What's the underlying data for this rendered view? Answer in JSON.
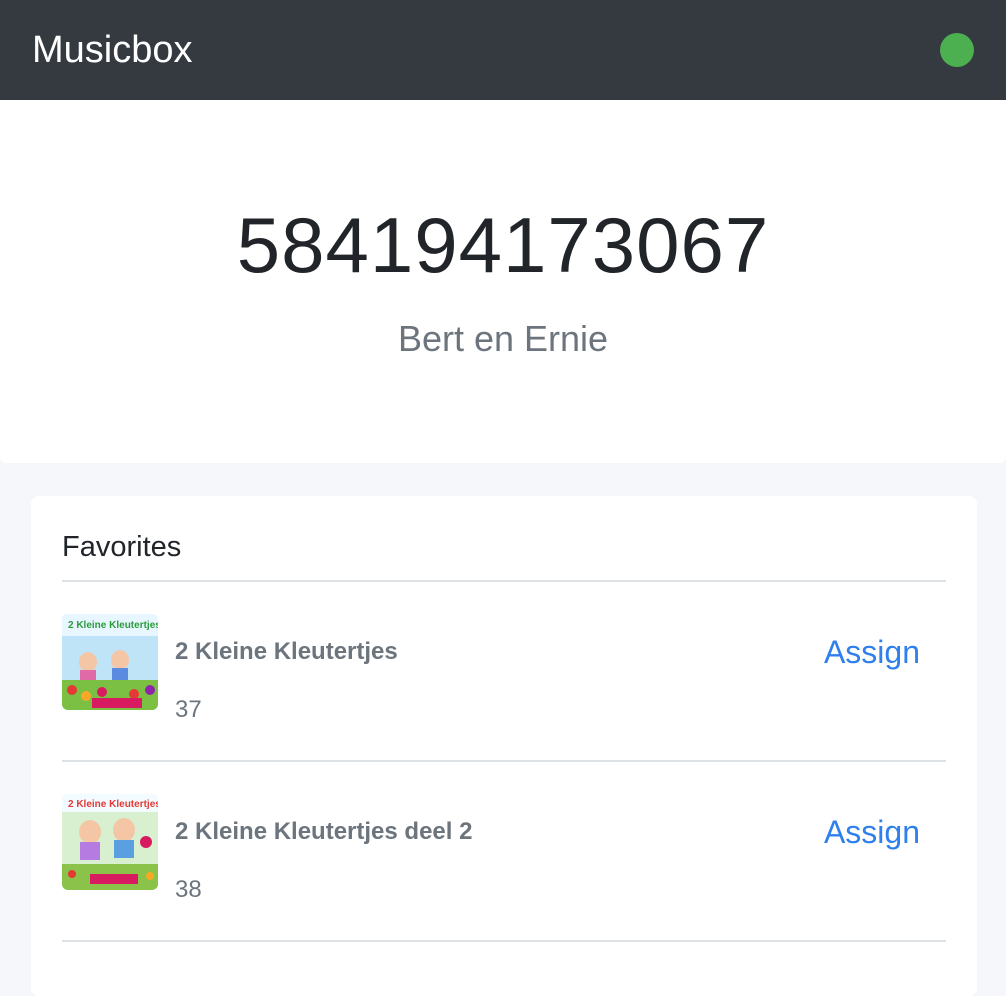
{
  "navbar": {
    "brand": "Musicbox",
    "status_color": "#4caf50"
  },
  "card": {
    "id": "584194173067",
    "name": "Bert en Ernie"
  },
  "favorites": {
    "title": "Favorites",
    "items": [
      {
        "title": "2 Kleine Kleutertjes",
        "count": "37",
        "action_label": "Assign",
        "cover_icon": "album-cover-image"
      },
      {
        "title": "2 Kleine Kleutertjes deel 2",
        "count": "38",
        "action_label": "Assign",
        "cover_icon": "album-cover-image"
      }
    ]
  },
  "colors": {
    "navbar_bg": "#343a40",
    "accent": "#2f80ed",
    "muted_text": "#6c757d"
  }
}
